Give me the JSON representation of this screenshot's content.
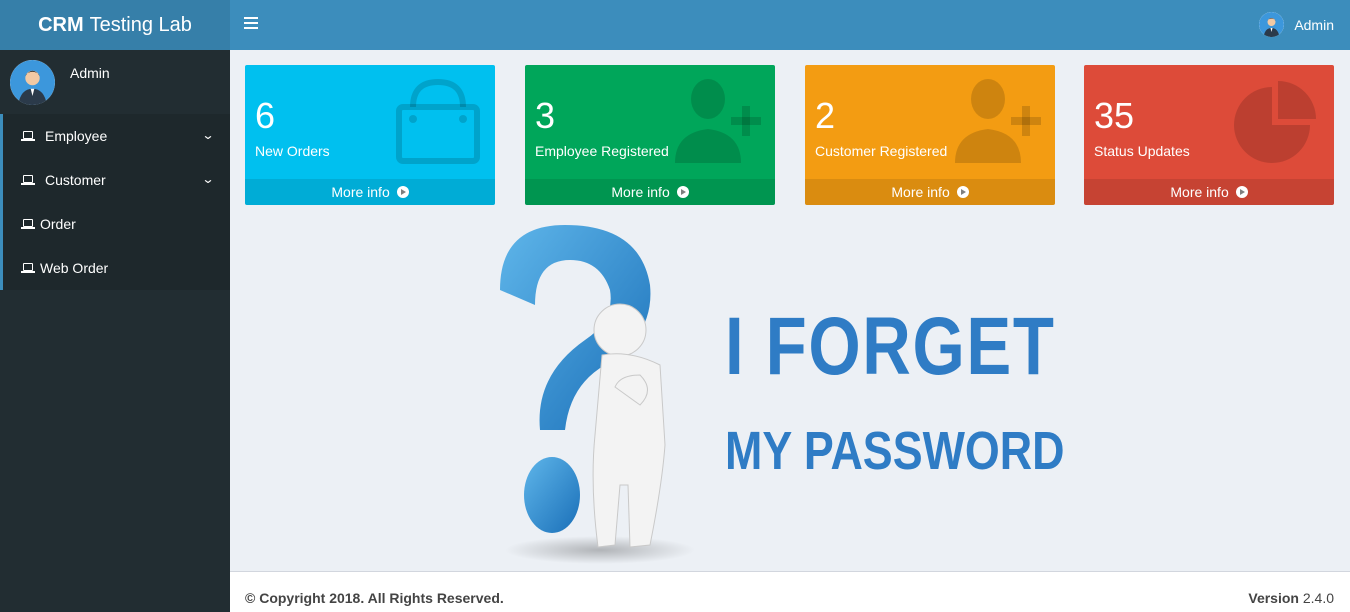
{
  "header": {
    "logo_bold": "CRM",
    "logo_rest": "Testing Lab",
    "user_name": "Admin"
  },
  "sidebar": {
    "user_name": "Admin",
    "items": [
      {
        "label": "Employee",
        "icon": "laptop-icon",
        "expandable": true
      },
      {
        "label": "Customer",
        "icon": "laptop-icon",
        "expandable": true
      },
      {
        "label": "Order",
        "icon": "laptop-icon",
        "expandable": false
      },
      {
        "label": "Web Order",
        "icon": "laptop-icon",
        "expandable": false
      }
    ]
  },
  "info_boxes": [
    {
      "value": "6",
      "label": "New Orders",
      "footer": "More info",
      "icon": "shopping-bag-icon",
      "color": "#00c0ef"
    },
    {
      "value": "3",
      "label": "Employee Registered",
      "footer": "More info",
      "icon": "user-plus-icon",
      "color": "#00a65a"
    },
    {
      "value": "2",
      "label": "Customer Registered",
      "footer": "More info",
      "icon": "user-plus-icon",
      "color": "#f39c12"
    },
    {
      "value": "35",
      "label": "Status Updates",
      "footer": "More info",
      "icon": "pie-chart-icon",
      "color": "#dd4b39"
    }
  ],
  "hero": {
    "line1": "I FORGET",
    "line2": "MY PASSWORD"
  },
  "footer": {
    "copyright": "© Copyright 2018. All Rights Reserved.",
    "version_label": "Version",
    "version_value": "2.4.0"
  },
  "colors": {
    "header": "#3c8dbc",
    "logo_bg": "#367fa9",
    "sidebar_bg": "#222d32",
    "accent_text": "#2f7cc5"
  }
}
